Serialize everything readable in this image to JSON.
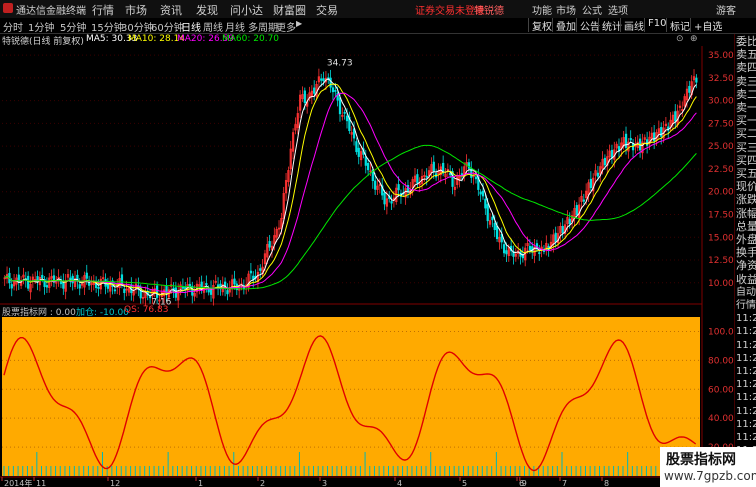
{
  "titlebar": {
    "app_name": "通达信金融终端",
    "menus": [
      "行情",
      "市场",
      "资讯",
      "发现",
      "问小达",
      "财富圈",
      "交易"
    ],
    "notice": "证券交易未登录",
    "stock_name": "特锐德",
    "right_items": [
      "功能",
      "市场",
      "公式",
      "选项",
      "游客"
    ]
  },
  "periods": [
    "分时",
    "1分钟",
    "5分钟",
    "15分钟",
    "30分钟",
    "60分钟",
    "日线",
    "周线",
    "月线",
    "多周期",
    "更多"
  ],
  "active_period": "日线",
  "tools": [
    "复权",
    "叠加",
    "公告",
    "统计",
    "画线",
    "F10",
    "标记",
    "+自选"
  ],
  "stock_bar": {
    "name": "特锐德(日线 前复权)",
    "ma5": "MA5: 30.33",
    "ma10": "MA10: 28.14",
    "ma20": "MA20: 26.59",
    "ma60": "MA60: 20.70"
  },
  "price_axis": [
    "35.00",
    "32.50",
    "30.00",
    "27.50",
    "25.00",
    "22.50",
    "20.00",
    "17.50",
    "15.00",
    "12.50",
    "10.00"
  ],
  "indicator_axis": [
    "100.0",
    "80.00",
    "60.00",
    "40.00",
    "20.00"
  ],
  "annotations": {
    "high": "34.73",
    "low": "7.16"
  },
  "indicator_bar": {
    "name": "股票指标网 : 0.00",
    "field1": "加仓: -10.00",
    "field2": "QS: 76.83"
  },
  "date_axis": [
    "2014年",
    "11",
    "12",
    "1",
    "2",
    "3",
    "4",
    "5",
    "6",
    "7",
    "8",
    "9",
    "10"
  ],
  "right_panel": [
    "委比",
    "卖五",
    "卖四",
    "卖三",
    "卖二",
    "卖一",
    "买一",
    "买二",
    "买三",
    "买四",
    "买五",
    "现价",
    "涨跌",
    "涨幅",
    "总量",
    "外盘",
    "换手",
    "净资",
    "收益",
    "自动",
    "行情",
    "11:2",
    "11:2",
    "11:2",
    "11:2",
    "11:2",
    "11:2",
    "11:2",
    "11:2",
    "11:2",
    "11:2",
    "11:2"
  ],
  "watermark": {
    "title": "股票指标网",
    "url": "www.7gpzb.com"
  },
  "colors": {
    "up": "#ff3232",
    "down": "#00e0e0",
    "ma5": "#ffffff",
    "ma10": "#ffff00",
    "ma20": "#ff00ff",
    "ma60": "#00e600",
    "indicator_bg": "#ffaa00",
    "indicator_line": "#e00000"
  }
}
